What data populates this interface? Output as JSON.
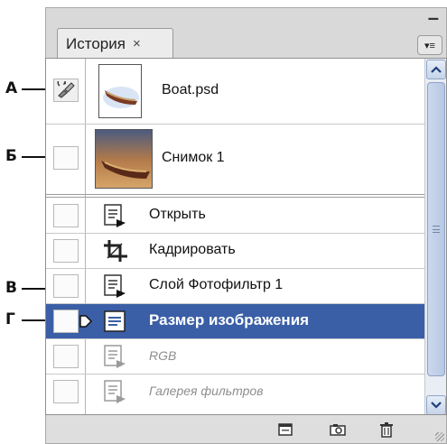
{
  "callouts": {
    "a": "А",
    "b": "Б",
    "v": "В",
    "g": "Г"
  },
  "panel": {
    "tab_label": "История",
    "tab_close": "×",
    "collapse": "–",
    "menu_glyph": "▾≡"
  },
  "snapshots": [
    {
      "label": "Boat.psd",
      "icon": "boat-thumbnail"
    },
    {
      "label": "Снимок 1",
      "icon": "boat-thumbnail"
    }
  ],
  "steps": [
    {
      "label": "Открыть",
      "icon": "history-state-icon",
      "state": "normal"
    },
    {
      "label": "Кадрировать",
      "icon": "crop-icon",
      "state": "normal"
    },
    {
      "label": "Слой Фотофильтр 1",
      "icon": "history-state-icon",
      "state": "normal"
    },
    {
      "label": "Размер изображения",
      "icon": "history-state-icon",
      "state": "selected"
    },
    {
      "label": "RGB",
      "icon": "history-state-icon",
      "state": "dimmed"
    },
    {
      "label": "Галерея фильтров",
      "icon": "history-state-icon",
      "state": "dimmed"
    }
  ],
  "footer": {
    "buttons": [
      "new-document-icon",
      "camera-icon",
      "trash-icon"
    ]
  },
  "colors": {
    "selected_row": "#3a5fa6",
    "scrollbar": "#b7c8e4"
  }
}
